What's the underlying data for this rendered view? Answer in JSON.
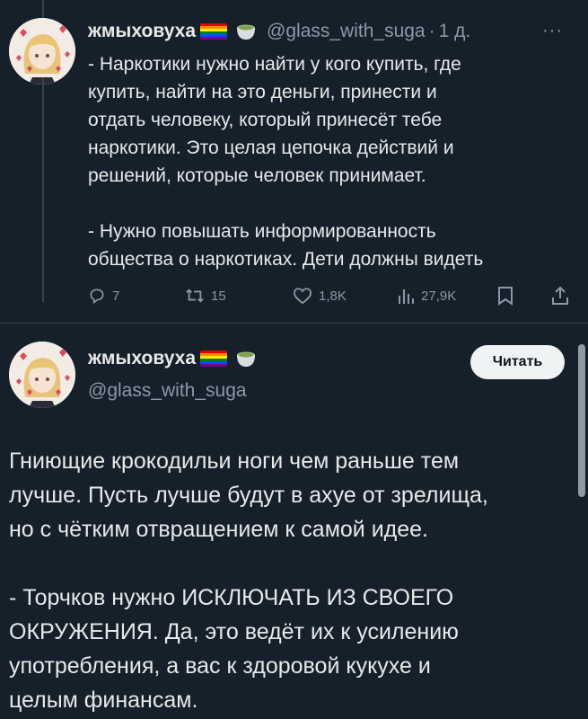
{
  "tweet1": {
    "name": "жмыховуха",
    "handle": "@glass_with_suga",
    "separator": "·",
    "time": "1 д.",
    "more": "···",
    "lines": [
      "- Наркотики нужно найти у кого купить, где",
      "купить, найти на это деньги, принести и",
      "отдать человеку, который принесёт тебе",
      "наркотики. Это целая цепочка действий и",
      "решений, которые человек принимает."
    ],
    "lines2": [
      "- Нужно повышать информированность",
      "общества о наркотиках. Дети должны видеть"
    ],
    "actions": {
      "replies": "7",
      "retweets": "15",
      "likes": "1,8K",
      "views": "27,9K"
    }
  },
  "tweet2": {
    "name": "жмыховуха",
    "handle": "@glass_with_suga",
    "follow_label": "Читать",
    "lines": [
      "Гниющие крокодильи ноги чем раньше тем",
      "лучше. Пусть лучше будут в ахуе от зрелища,",
      "но с чётким отвращением к самой идее."
    ],
    "lines2": [
      "- Торчков нужно ИСКЛЮЧАТЬ ИЗ СВОЕГО",
      "ОКРУЖЕНИЯ. Да, это ведёт их к усилению",
      "употребления, а вас к здоровой кукухе и",
      "целым финансам."
    ]
  },
  "icons": {
    "flag": "rainbow-flag-icon",
    "cup": "tea-cup-icon",
    "reply": "reply-icon",
    "retweet": "retweet-icon",
    "like": "heart-icon",
    "views": "views-icon",
    "bookmark": "bookmark-icon",
    "share": "share-icon"
  },
  "colors": {
    "background": "#15202b",
    "text": "#e7e9ea",
    "muted": "#8b98a5",
    "divider": "#38444d",
    "button_bg": "#eff3f4"
  }
}
